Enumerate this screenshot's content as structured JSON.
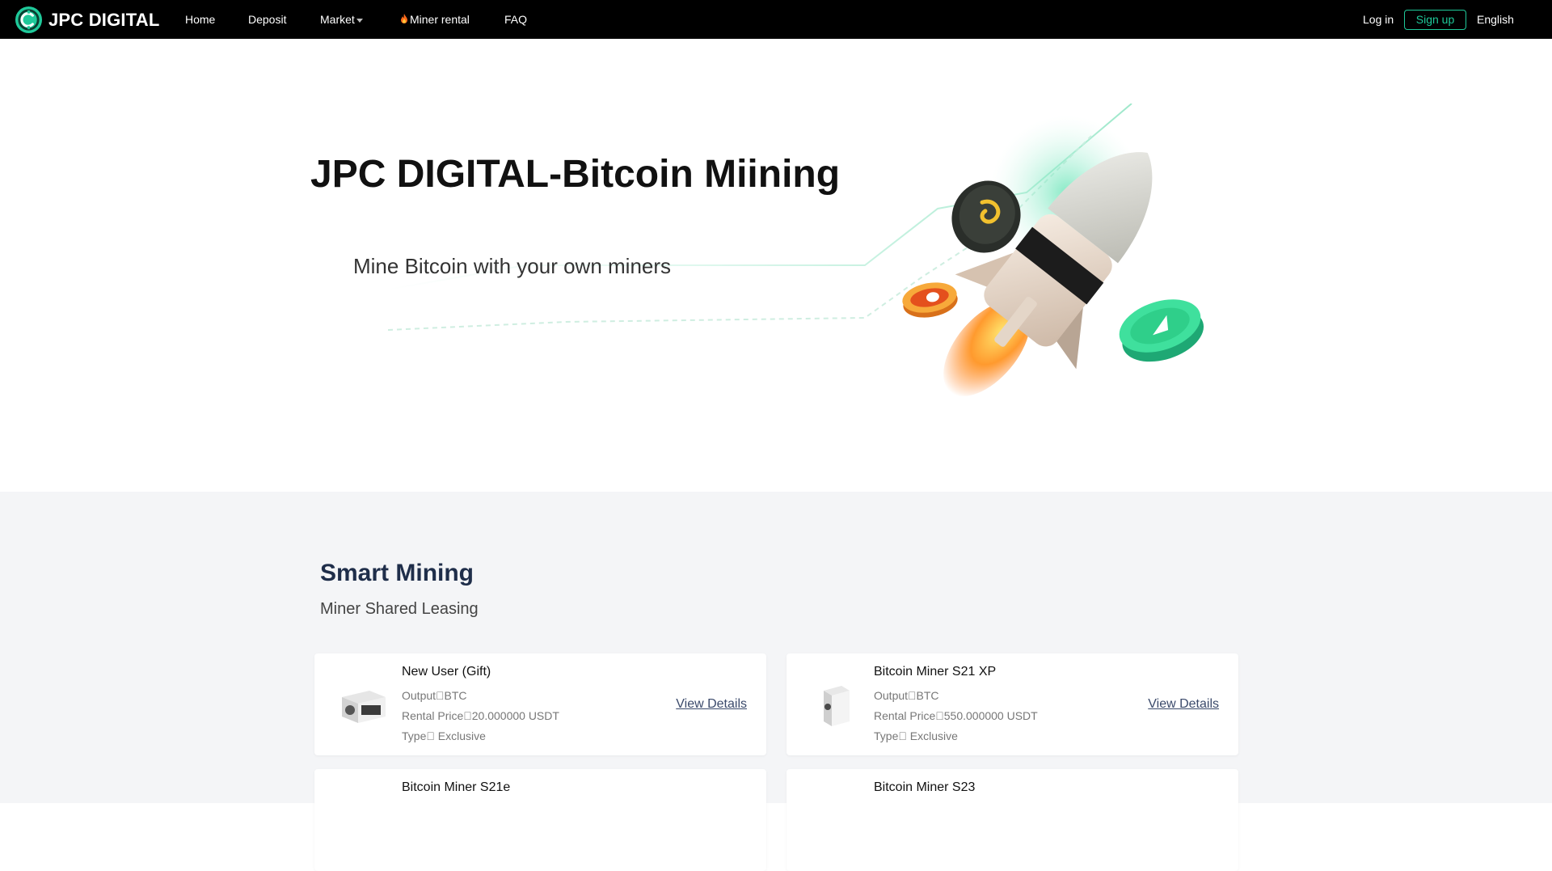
{
  "nav": {
    "brand": "JPC DIGITAL",
    "links": {
      "home": "Home",
      "deposit": "Deposit",
      "market": "Market",
      "miner_rental": "Miner rental",
      "faq": "FAQ"
    },
    "login": "Log in",
    "signup": "Sign up",
    "language": "English"
  },
  "hero": {
    "title": "JPC DIGITAL-Bitcoin Miining",
    "subtitle": "Mine Bitcoin with your own miners"
  },
  "section": {
    "title": "Smart Mining",
    "subtitle": "Miner Shared Leasing"
  },
  "cards": [
    {
      "name": "New User (Gift)",
      "output": "Output\u0000BTC",
      "price": "Rental Price\u000020.000000 USDT",
      "type": "Type\u0000 Exclusive",
      "action": "View Details"
    },
    {
      "name": "Bitcoin Miner S21 XP",
      "output": "Output\u0000BTC",
      "price": "Rental Price\u0000550.000000 USDT",
      "type": "Type\u0000 Exclusive",
      "action": "View Details"
    },
    {
      "name": "Bitcoin Miner S21e"
    },
    {
      "name": "Bitcoin Miner S23"
    }
  ],
  "colors": {
    "accent": "#1fc99a",
    "nav_bg": "#000000",
    "section_bg": "#f4f5f7",
    "heading": "#1f2e4a"
  }
}
